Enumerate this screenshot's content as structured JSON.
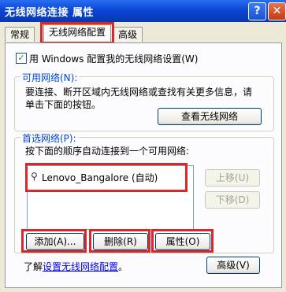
{
  "window": {
    "title": "无线网络连接 属性",
    "help_btn": "?",
    "close_btn": "✕"
  },
  "tabs": [
    "常规",
    "无线网络配置",
    "高级"
  ],
  "config_checkbox": {
    "label": "用 Windows 配置我的无线网络设置(W)",
    "checked": true
  },
  "available": {
    "legend": "可用网络(N):",
    "desc_line1": "要连接、断开区域内无线网络或查找有关更多信息，请",
    "desc_line2": "单击下面的按钮。",
    "view_button": "查看无线网络"
  },
  "preferred": {
    "legend": "首选网络(P):",
    "desc": "按下面的顺序自动连接到一个可用网络:",
    "networks": [
      {
        "name": "Lenovo_Bangalore (自动)"
      }
    ],
    "up_button": "上移(U)",
    "down_button": "下移(D)",
    "add_button": "添加(A)...",
    "remove_button": "删除(R)",
    "props_button": "属性(O)"
  },
  "footer": {
    "learn_prefix": "了解",
    "learn_link": "设置无线网络配置",
    "learn_suffix": "。",
    "advanced_button": "高级(V)"
  },
  "colors": {
    "titlebar": "#0a47d6",
    "highlight": "#d7282c",
    "face": "#ece9d8"
  }
}
